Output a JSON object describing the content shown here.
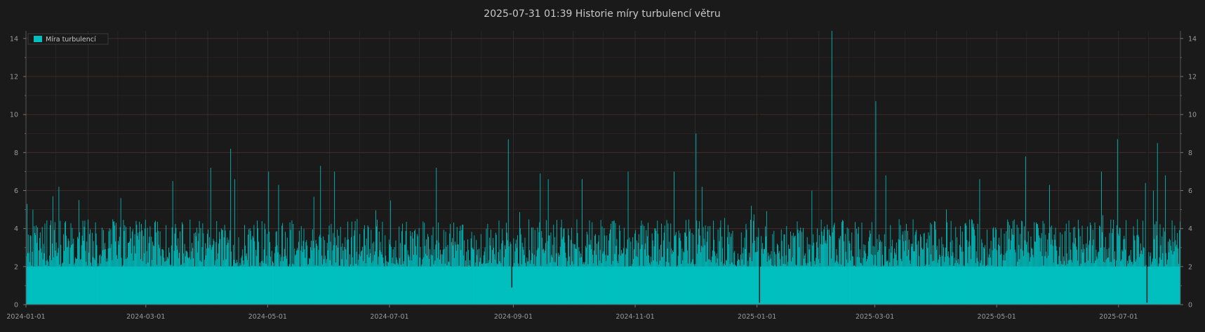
{
  "chart_data": {
    "type": "bar",
    "title": "2025-07-31  01:39  Historie míry turbulencí větru",
    "xlabel": "",
    "ylabel": "",
    "x_range": [
      "2024-01-01",
      "2025-07-31"
    ],
    "ylim": [
      0,
      14.4
    ],
    "y_ticks": [
      0,
      2,
      4,
      6,
      8,
      10,
      12,
      14
    ],
    "x_ticks": [
      "2024-01-01",
      "2024-03-01",
      "2024-05-01",
      "2024-07-01",
      "2024-09-01",
      "2024-11-01",
      "2025-01-01",
      "2025-03-01",
      "2025-05-01",
      "2025-07-01"
    ],
    "grid": true,
    "legend_position": "top-left",
    "series": [
      {
        "name": "Míra turbulencí",
        "color": "#00bfbf",
        "baseline_mean": 3.0,
        "typical_range": [
          2.0,
          4.5
        ],
        "peaks": [
          {
            "date": "2024-01-01",
            "value": 5.3
          },
          {
            "date": "2024-01-04",
            "value": 5.0
          },
          {
            "date": "2024-01-14",
            "value": 5.7
          },
          {
            "date": "2024-01-17",
            "value": 6.2
          },
          {
            "date": "2024-01-27",
            "value": 5.5
          },
          {
            "date": "2024-02-17",
            "value": 5.6
          },
          {
            "date": "2024-03-14",
            "value": 6.5
          },
          {
            "date": "2024-04-02",
            "value": 7.2
          },
          {
            "date": "2024-04-12",
            "value": 8.2
          },
          {
            "date": "2024-04-14",
            "value": 6.6
          },
          {
            "date": "2024-05-01",
            "value": 7.0
          },
          {
            "date": "2024-05-06",
            "value": 6.3
          },
          {
            "date": "2024-05-27",
            "value": 7.3
          },
          {
            "date": "2024-06-03",
            "value": 7.0
          },
          {
            "date": "2024-07-24",
            "value": 7.2
          },
          {
            "date": "2024-08-29",
            "value": 8.7
          },
          {
            "date": "2024-08-31",
            "value": 0.9
          },
          {
            "date": "2024-09-14",
            "value": 6.9
          },
          {
            "date": "2024-09-18",
            "value": 6.6
          },
          {
            "date": "2024-10-05",
            "value": 6.6
          },
          {
            "date": "2024-10-28",
            "value": 7.0
          },
          {
            "date": "2024-11-20",
            "value": 7.0
          },
          {
            "date": "2024-12-01",
            "value": 9.0
          },
          {
            "date": "2024-12-04",
            "value": 6.2
          },
          {
            "date": "2025-01-02",
            "value": 0.1
          },
          {
            "date": "2025-01-28",
            "value": 6.0
          },
          {
            "date": "2025-02-07",
            "value": 14.4
          },
          {
            "date": "2025-03-01",
            "value": 10.7
          },
          {
            "date": "2025-03-06",
            "value": 6.8
          },
          {
            "date": "2025-04-22",
            "value": 6.6
          },
          {
            "date": "2025-05-15",
            "value": 7.8
          },
          {
            "date": "2025-05-27",
            "value": 6.3
          },
          {
            "date": "2025-06-22",
            "value": 7.0
          },
          {
            "date": "2025-06-30",
            "value": 8.7
          },
          {
            "date": "2025-07-14",
            "value": 6.4
          },
          {
            "date": "2025-07-15",
            "value": 0.1
          },
          {
            "date": "2025-07-18",
            "value": 6.0
          },
          {
            "date": "2025-07-20",
            "value": 8.5
          },
          {
            "date": "2025-07-24",
            "value": 6.8
          }
        ]
      }
    ]
  }
}
